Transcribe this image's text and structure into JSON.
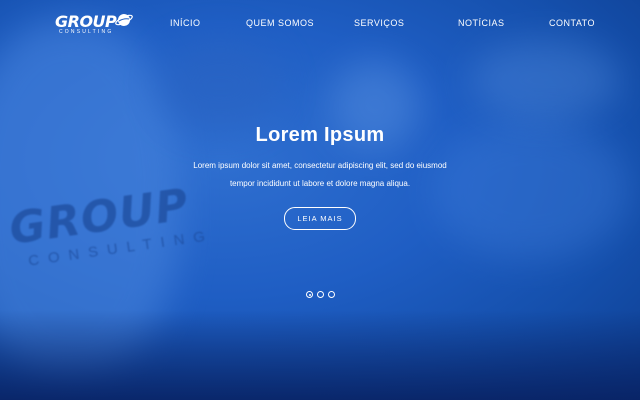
{
  "brand": {
    "name": "GROUP",
    "tagline": "CONSULTING"
  },
  "nav": {
    "items": [
      {
        "label": "INÍCIO"
      },
      {
        "label": "QUEM SOMOS"
      },
      {
        "label": "SERVIÇOS"
      },
      {
        "label": "NOTÍCIAS"
      },
      {
        "label": "CONTATO"
      }
    ]
  },
  "hero": {
    "title": "Lorem Ipsum",
    "text_line1": "Lorem ipsum dolor sit amet, consectetur adipiscing elit, sed do eiusmod",
    "text_line2": "tempor incididunt ut labore et dolore magna aliqua.",
    "cta_label": "LEIA MAIS",
    "background_logo": {
      "name": "GROUP",
      "tagline": "CONSULTING"
    }
  },
  "slider": {
    "slide_count": 3,
    "active_index": 0
  },
  "colors": {
    "primary": "#1f5ec4",
    "dark": "#0d3d8f",
    "text": "#ffffff"
  },
  "icons": {
    "logo": "globe-orbit-icon"
  }
}
